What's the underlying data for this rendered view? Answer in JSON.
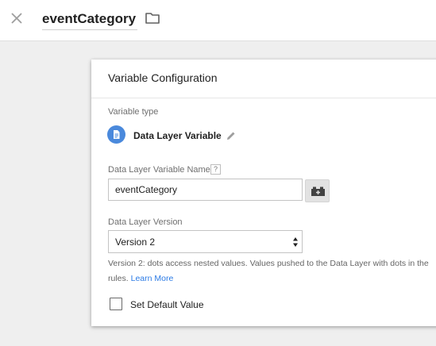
{
  "header": {
    "title": "eventCategory",
    "close_icon": "close-icon",
    "folder_icon": "folder-icon"
  },
  "card": {
    "title": "Variable Configuration",
    "variable_type": {
      "label": "Variable type",
      "name": "Data Layer Variable",
      "icon": "document-icon",
      "icon_color": "#4a89dc"
    },
    "dlv_name": {
      "label": "Data Layer Variable Name",
      "help": "?",
      "value": "eventCategory",
      "picker_icon": "lego-brick-icon"
    },
    "dl_version": {
      "label": "Data Layer Version",
      "selected": "Version 2",
      "help_text": "Version 2: dots access nested values. Values pushed to the Data Layer with dots in the",
      "help_text_2": "rules.",
      "learn_more": "Learn More",
      "link_color": "#2c7be5"
    },
    "default_value": {
      "label": "Set Default Value",
      "checked": false
    }
  }
}
